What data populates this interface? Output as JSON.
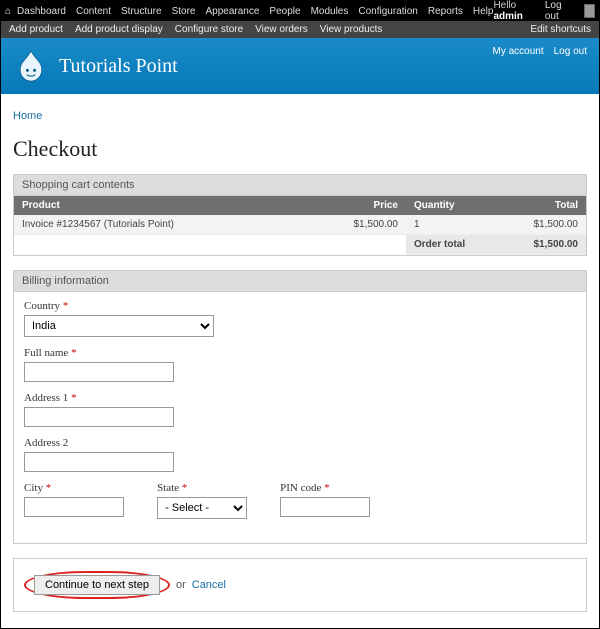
{
  "topmenu": {
    "items": [
      "Dashboard",
      "Content",
      "Structure",
      "Store",
      "Appearance",
      "People",
      "Modules",
      "Configuration",
      "Reports",
      "Help"
    ],
    "hello_prefix": "Hello ",
    "hello_user": "admin",
    "logout": "Log out"
  },
  "submenu": {
    "left": [
      "Add product",
      "Add product display",
      "Configure store",
      "View orders",
      "View products"
    ],
    "right": "Edit shortcuts"
  },
  "header": {
    "title": "Tutorials Point",
    "links": [
      "My account",
      "Log out"
    ]
  },
  "breadcrumb": "Home",
  "page_title": "Checkout",
  "cart": {
    "panel": "Shopping cart contents",
    "cols": {
      "product": "Product",
      "price": "Price",
      "qty": "Quantity",
      "total": "Total"
    },
    "rows": [
      {
        "product": "Invoice #1234567 (Tutorials Point)",
        "price": "$1,500.00",
        "qty": "1",
        "total": "$1,500.00"
      }
    ],
    "order_label": "Order total",
    "order_total": "$1,500.00"
  },
  "billing": {
    "panel": "Billing information",
    "country": {
      "label": "Country",
      "value": "India"
    },
    "fullname": {
      "label": "Full name"
    },
    "addr1": {
      "label": "Address 1"
    },
    "addr2": {
      "label": "Address 2"
    },
    "city": {
      "label": "City"
    },
    "state": {
      "label": "State",
      "value": "- Select -"
    },
    "pin": {
      "label": "PIN code"
    }
  },
  "actions": {
    "continue": "Continue to next step",
    "or": "or",
    "cancel": "Cancel"
  }
}
